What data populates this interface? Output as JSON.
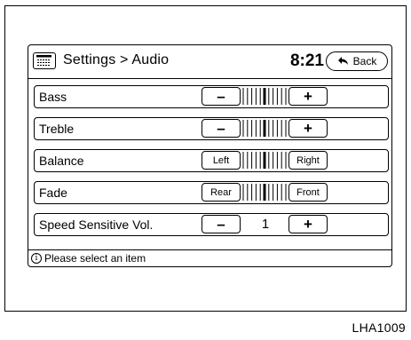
{
  "header": {
    "title": "Settings > Audio",
    "clock": "8:21",
    "back_label": "Back",
    "menu_icon": "list-menu-icon",
    "back_icon": "return-arrow-icon"
  },
  "rows": [
    {
      "label": "Bass",
      "control": "slider",
      "left": "–",
      "right": "+",
      "level": 0.5
    },
    {
      "label": "Treble",
      "control": "slider",
      "left": "–",
      "right": "+",
      "level": 0.5
    },
    {
      "label": "Balance",
      "control": "slider",
      "left": "Left",
      "right": "Right",
      "level": 0.5
    },
    {
      "label": "Fade",
      "control": "slider",
      "left": "Rear",
      "right": "Front",
      "level": 0.5
    },
    {
      "label": "Speed Sensitive Vol.",
      "control": "stepper",
      "left": "–",
      "right": "+",
      "value": "1"
    }
  ],
  "status": {
    "icon": "info-icon",
    "message": "Please select an item"
  },
  "figure_code": "LHA1009"
}
